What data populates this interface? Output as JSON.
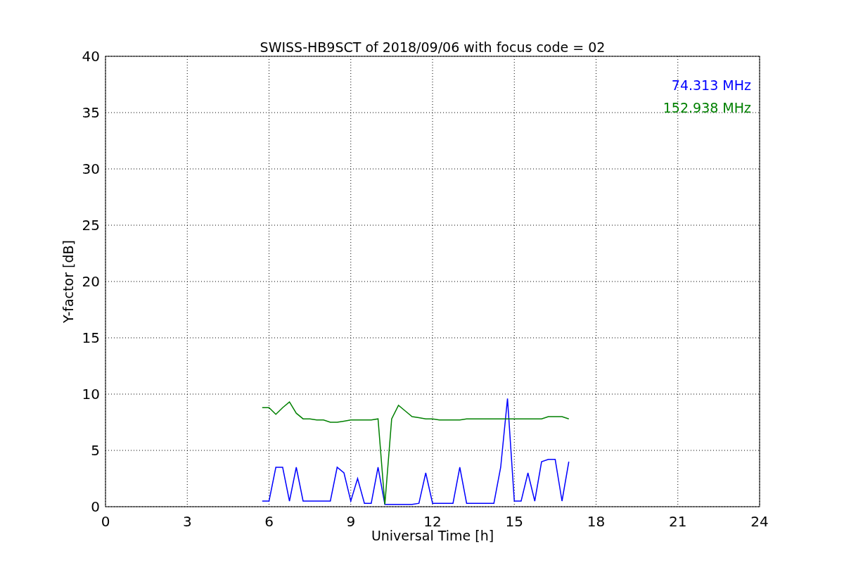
{
  "figure": {
    "chart_data": {
      "type": "line",
      "title": "SWISS-HB9SCT of 2018/09/06 with focus code = 02",
      "xlabel": "Universal Time [h]",
      "ylabel": "Y-factor [dB]",
      "x": [
        5.75,
        6,
        6.25,
        6.5,
        6.75,
        7,
        7.25,
        7.5,
        7.75,
        8,
        8.25,
        8.5,
        8.75,
        9,
        9.25,
        9.5,
        9.75,
        10,
        10.25,
        10.5,
        10.75,
        11,
        11.25,
        11.5,
        11.75,
        12,
        12.25,
        12.5,
        12.75,
        13,
        13.25,
        13.5,
        13.75,
        14,
        14.25,
        14.5,
        14.75,
        15,
        15.25,
        15.5,
        15.75,
        16,
        16.25,
        16.5,
        16.75,
        17
      ],
      "series": [
        {
          "name": "74.313 MHz",
          "color": "#0000ff",
          "values": [
            0.5,
            0.5,
            3.5,
            3.5,
            0.5,
            3.5,
            0.5,
            0.5,
            0.5,
            0.5,
            0.5,
            3.5,
            3,
            0.5,
            2.5,
            0.3,
            0.3,
            3.5,
            0.2,
            0.2,
            0.2,
            0.2,
            0.2,
            0.3,
            3,
            0.3,
            0.3,
            0.3,
            0.3,
            3.5,
            0.3,
            0.3,
            0.3,
            0.3,
            0.3,
            3.5,
            9.6,
            0.5,
            0.5,
            3,
            0.5,
            4,
            4.2,
            4.2,
            0.5,
            4
          ]
        },
        {
          "name": "152.938 MHz",
          "color": "#008000",
          "values": [
            8.8,
            8.8,
            8.2,
            8.8,
            9.3,
            8.3,
            7.8,
            7.8,
            7.7,
            7.7,
            7.5,
            7.5,
            7.6,
            7.7,
            7.7,
            7.7,
            7.7,
            7.8,
            0.2,
            7.8,
            9,
            8.5,
            8,
            7.9,
            7.8,
            7.8,
            7.7,
            7.7,
            7.7,
            7.7,
            7.8,
            7.8,
            7.8,
            7.8,
            7.8,
            7.8,
            7.8,
            7.8,
            7.8,
            7.8,
            7.8,
            7.8,
            8,
            8,
            8,
            7.8
          ]
        }
      ],
      "xlim": [
        0,
        24
      ],
      "ylim": [
        0,
        40
      ],
      "xticks": [
        0,
        3,
        6,
        9,
        12,
        15,
        18,
        21,
        24
      ],
      "yticks": [
        0,
        5,
        10,
        15,
        20,
        25,
        30,
        35,
        40
      ],
      "grid": true
    }
  }
}
